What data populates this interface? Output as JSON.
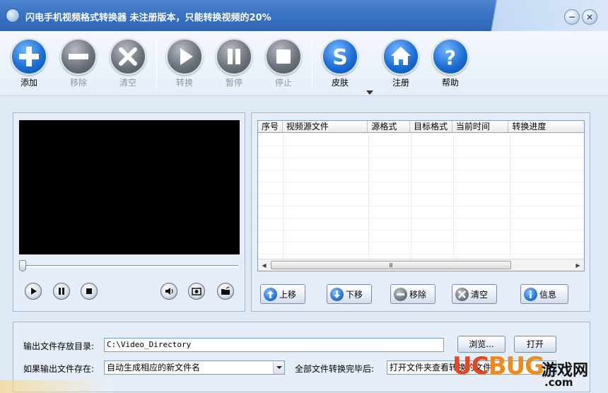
{
  "window": {
    "title": "闪电手机视频格式转换器   未注册版本，只能转换视频的20%",
    "minimize_glyph": "−",
    "close_glyph": "×"
  },
  "toolbar": {
    "buttons": [
      {
        "id": "add",
        "label": "添加",
        "enabled": true,
        "icon": "plus-icon"
      },
      {
        "id": "remove",
        "label": "移除",
        "enabled": false,
        "icon": "minus-icon"
      },
      {
        "id": "clear",
        "label": "清空",
        "enabled": false,
        "icon": "x-icon"
      },
      {
        "id": "convert",
        "label": "转换",
        "enabled": false,
        "icon": "play-icon"
      },
      {
        "id": "pause",
        "label": "暂停",
        "enabled": false,
        "icon": "pause-icon"
      },
      {
        "id": "stop",
        "label": "停止",
        "enabled": false,
        "icon": "stop-icon"
      },
      {
        "id": "skin",
        "label": "皮肤",
        "enabled": true,
        "icon": "skin-s-icon"
      },
      {
        "id": "register",
        "label": "注册",
        "enabled": true,
        "icon": "home-icon"
      },
      {
        "id": "help",
        "label": "帮助",
        "enabled": true,
        "icon": "question-icon"
      }
    ]
  },
  "player": {
    "controls": [
      "play-icon",
      "pause-icon",
      "stop-icon",
      "volume-icon",
      "snapshot-icon",
      "folder-icon"
    ]
  },
  "file_list": {
    "columns": [
      "序号",
      "视频源文件",
      "源格式",
      "目标格式",
      "当前时间",
      "转换进度"
    ],
    "rows": [],
    "scroll_grip": "Ⅲ",
    "buttons": [
      {
        "label": "上移",
        "icon": "arrow-up-icon"
      },
      {
        "label": "下移",
        "icon": "arrow-down-icon"
      },
      {
        "label": "移除",
        "icon": "minus-icon"
      },
      {
        "label": "清空",
        "icon": "x-icon"
      },
      {
        "label": "信息",
        "icon": "info-icon"
      }
    ]
  },
  "output": {
    "dir_label": "输出文件存放目录:",
    "dir_value": "C:\\Video_Directory",
    "browse_label": "浏览...",
    "open_label": "打开",
    "exists_label": "如果输出文件存在:",
    "exists_value": "自动生成相应的新文件名",
    "after_label": "全部文件转换完毕后:",
    "after_value": "打开文件夹查看转换的文件"
  },
  "watermark": {
    "uc": "UC",
    "bug": "BUG",
    "cn": "游戏网",
    "com": ".com"
  },
  "colors": {
    "titlebar": "#3a72c4",
    "accent_blue": "#1e6fd6",
    "disabled_grey": "#6d747e",
    "panel_bg": "#e4edf8"
  }
}
